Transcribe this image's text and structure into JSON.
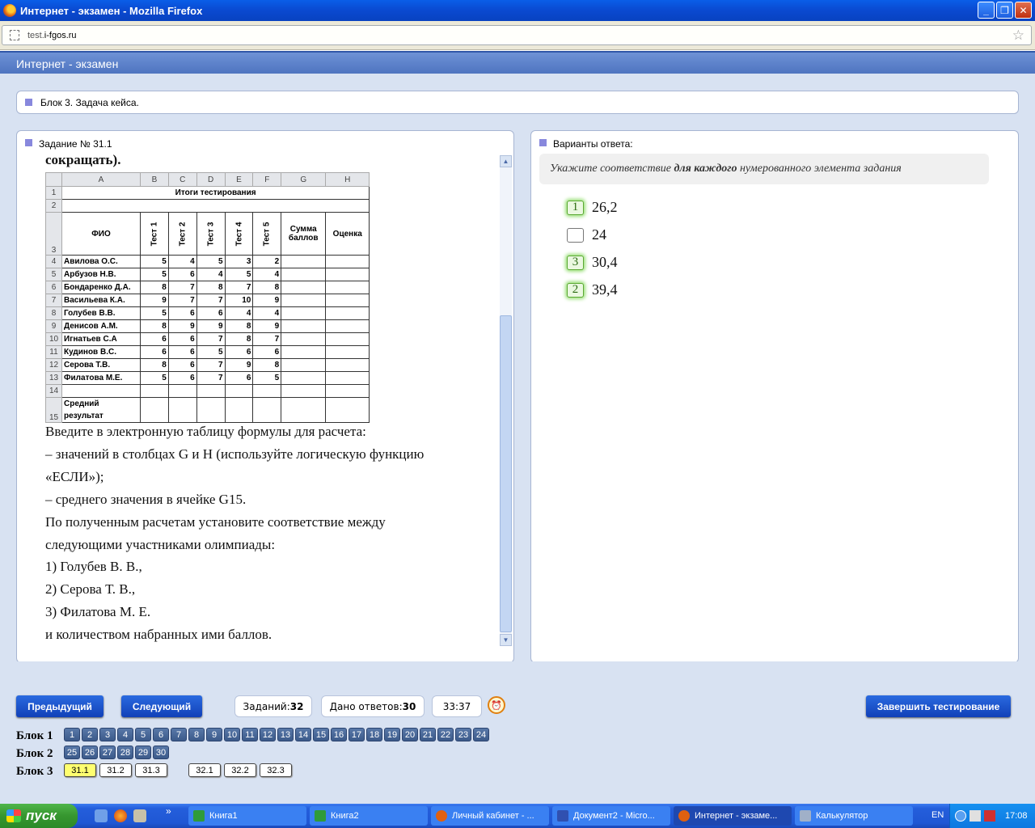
{
  "window": {
    "title": "Интернет - экзамен - Mozilla Firefox",
    "buttons": {
      "minimize": "_",
      "maximize": "❐",
      "close": "✕"
    }
  },
  "browser": {
    "url_prefix": "test.",
    "url_domain": "i-fgos.ru",
    "bookmark_icon": "☆"
  },
  "app": {
    "header": "Интернет - экзамен",
    "block_title": "Блок 3. Задача кейса."
  },
  "task": {
    "title": "Задание № 31.1",
    "partial_line": "сокращать).",
    "lines": [
      "Введите в электронную таблицу формулы для расчета:",
      "– значений в столбцах G и H (используйте логическую функцию",
      "«ЕСЛИ»);",
      "– среднего значения в ячейке G15.",
      "По полученным расчетам установите соответствие между",
      "следующими участниками олимпиады:",
      "1) Голубев В. В.,",
      "2) Серова Т. В.,",
      "3) Филатова М. Е.",
      "и количеством набранных ими баллов."
    ],
    "sheet": {
      "col_headers": [
        "A",
        "B",
        "C",
        "D",
        "E",
        "F",
        "G",
        "H"
      ],
      "title": "Итоги тестирования",
      "head_fio": "ФИО",
      "head_tests": [
        "Тест 1",
        "Тест 2",
        "Тест 3",
        "Тест 4",
        "Тест 5"
      ],
      "head_sum": "Сумма баллов",
      "head_grade": "Оценка",
      "rows": [
        {
          "n": "4",
          "name": "Авилова О.С.",
          "v": [
            "5",
            "4",
            "5",
            "3",
            "2"
          ]
        },
        {
          "n": "5",
          "name": "Арбузов Н.В.",
          "v": [
            "5",
            "6",
            "4",
            "5",
            "4"
          ]
        },
        {
          "n": "6",
          "name": "Бондаренко Д.А.",
          "v": [
            "8",
            "7",
            "8",
            "7",
            "8"
          ]
        },
        {
          "n": "7",
          "name": "Васильева К.А.",
          "v": [
            "9",
            "7",
            "7",
            "10",
            "9"
          ]
        },
        {
          "n": "8",
          "name": "Голубев В.В.",
          "v": [
            "5",
            "6",
            "6",
            "4",
            "4"
          ]
        },
        {
          "n": "9",
          "name": "Денисов А.М.",
          "v": [
            "8",
            "9",
            "9",
            "8",
            "9"
          ]
        },
        {
          "n": "10",
          "name": "Игнатьев С.А",
          "v": [
            "6",
            "6",
            "7",
            "8",
            "7"
          ]
        },
        {
          "n": "11",
          "name": "Кудинов В.С.",
          "v": [
            "6",
            "6",
            "5",
            "6",
            "6"
          ]
        },
        {
          "n": "12",
          "name": "Серова Т.В.",
          "v": [
            "8",
            "6",
            "7",
            "9",
            "8"
          ]
        },
        {
          "n": "13",
          "name": "Филатова М.Е.",
          "v": [
            "5",
            "6",
            "7",
            "6",
            "5"
          ]
        }
      ],
      "row_numbers": [
        "1",
        "2",
        "3",
        "14",
        "15"
      ],
      "avg_label": "Средний результат"
    }
  },
  "answers": {
    "title": "Варианты ответа:",
    "instruction_pre": "Укажите соответствие ",
    "instruction_bold": "для каждого",
    "instruction_post": " нумерованного элемента задания",
    "options": [
      {
        "mark": "1",
        "value": "26,2"
      },
      {
        "mark": "",
        "value": "24"
      },
      {
        "mark": "3",
        "value": "30,4"
      },
      {
        "mark": "2",
        "value": "39,4"
      }
    ]
  },
  "nav": {
    "prev": "Предыдущий",
    "next": "Следующий",
    "tasks_label": "Заданий: ",
    "tasks_count": "32",
    "answered_label": "Дано ответов: ",
    "answered_count": "30",
    "timer": "33:37",
    "finish": "Завершить тестирование",
    "block1_label": "Блок 1",
    "block2_label": "Блок 2",
    "block3_label": "Блок 3",
    "block1": [
      "1",
      "2",
      "3",
      "4",
      "5",
      "6",
      "7",
      "8",
      "9",
      "10",
      "11",
      "12",
      "13",
      "14",
      "15",
      "16",
      "17",
      "18",
      "19",
      "20",
      "21",
      "22",
      "23",
      "24"
    ],
    "block2": [
      "25",
      "26",
      "27",
      "28",
      "29",
      "30"
    ],
    "block3": [
      "31.1",
      "31.2",
      "31.3",
      "32.1",
      "32.2",
      "32.3"
    ]
  },
  "taskbar": {
    "start": "пуск",
    "tasks": [
      "Книга1",
      "Книга2",
      "Личный кабинет - ...",
      "Документ2 - Micro...",
      "Интернет - экзаме...",
      "Калькулятор"
    ],
    "lang": "EN",
    "time": "17:08",
    "chevron": "»"
  }
}
